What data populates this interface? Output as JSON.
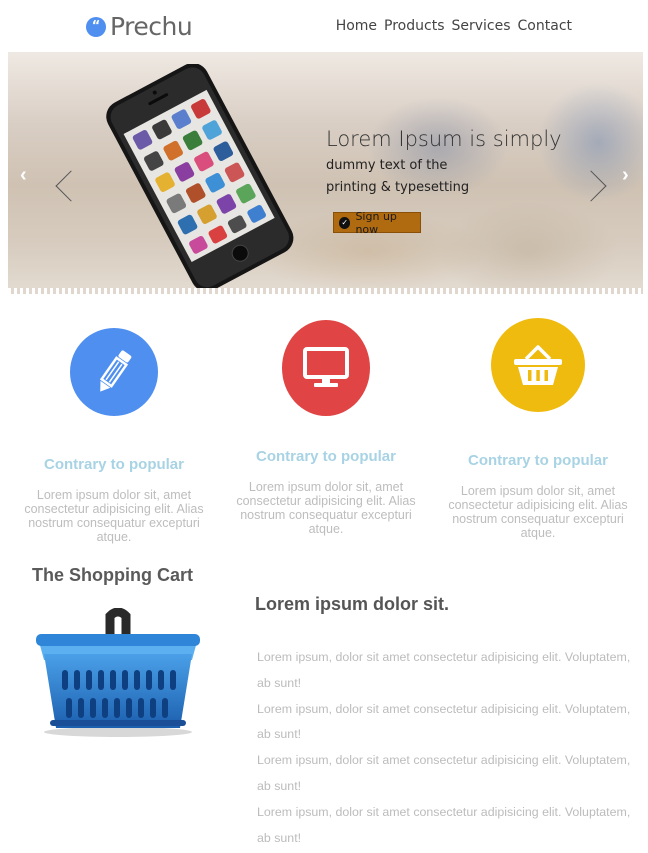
{
  "header": {
    "logo_mark": "“",
    "brand": "Prechu",
    "nav": [
      "Home",
      "Products",
      "Services",
      "Contact"
    ]
  },
  "hero": {
    "title": "Lorem Ipsum is simply",
    "line1": "dummy text of the",
    "line2": "printing & typesetting",
    "cta_label": "Sign up now",
    "prev_arrow": "‹",
    "next_arrow": "›",
    "icon": "smartphone-image"
  },
  "features": [
    {
      "icon": "pencil-icon",
      "color": "#4e8ff0",
      "title": "Contrary to popular",
      "text": "Lorem ipsum dolor sit, amet consectetur adipisicing elit. Alias nostrum consequatur excepturi atque."
    },
    {
      "icon": "monitor-icon",
      "color": "#e04444",
      "title": "Contrary to popular",
      "text": "Lorem ipsum dolor sit, amet consectetur adipisicing elit. Alias nostrum consequatur excepturi atque."
    },
    {
      "icon": "basket-icon",
      "color": "#f0bb0f",
      "title": "Contrary to popular",
      "text": "Lorem ipsum dolor sit, amet consectetur adipisicing elit. Alias nostrum consequatur excepturi atque."
    }
  ],
  "cart": {
    "heading": "The Shopping Cart",
    "image": "shopping-basket-image"
  },
  "content": {
    "heading": "Lorem ipsum dolor sit.",
    "paragraphs": [
      "Lorem ipsum, dolor sit amet consectetur adipisicing elit. Voluptatem, ab sunt!",
      "Lorem ipsum, dolor sit amet consectetur adipisicing elit. Voluptatem, ab sunt!",
      "Lorem ipsum, dolor sit amet consectetur adipisicing elit. Voluptatem, ab sunt!",
      "Lorem ipsum, dolor sit amet consectetur adipisicing elit. Voluptatem, ab sunt!"
    ]
  }
}
